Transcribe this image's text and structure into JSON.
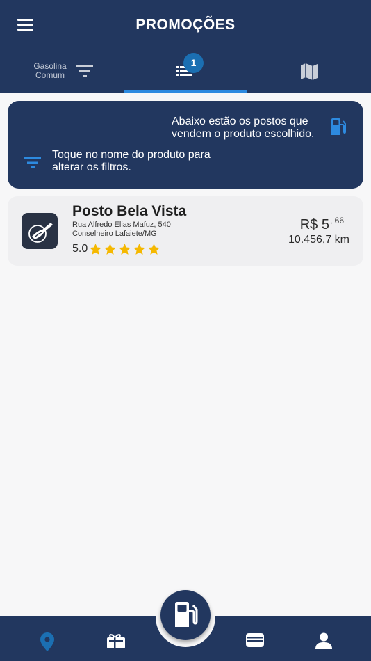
{
  "header": {
    "title": "PROMOÇÕES"
  },
  "tabs": {
    "product_label": "Gasolina Comum",
    "list_badge": "1",
    "active_tab": "list"
  },
  "info_card": {
    "text_products": "Abaixo estão os postos que vendem o produto escolhido.",
    "text_filters": "Toque no nome do produto para alterar os filtros."
  },
  "stations": [
    {
      "name": "Posto Bela Vista",
      "address_line1": "Rua Alfredo Elias Mafuz, 540",
      "address_line2": "Conselheiro Lafaiete/MG",
      "rating": "5.0",
      "stars": 5,
      "price_main": "R$ 5",
      "price_cents": ", 66",
      "distance": "10.456,7 km"
    }
  ],
  "bottom_nav": {
    "active_color": "#1b6fb2",
    "icons": [
      "location-pin-icon",
      "gift-card-icon",
      "fuel-pump-icon",
      "wallet-icon",
      "user-icon"
    ]
  },
  "colors": {
    "primary": "#22375f",
    "accent": "#2d8ae0",
    "star": "#f5b800"
  }
}
